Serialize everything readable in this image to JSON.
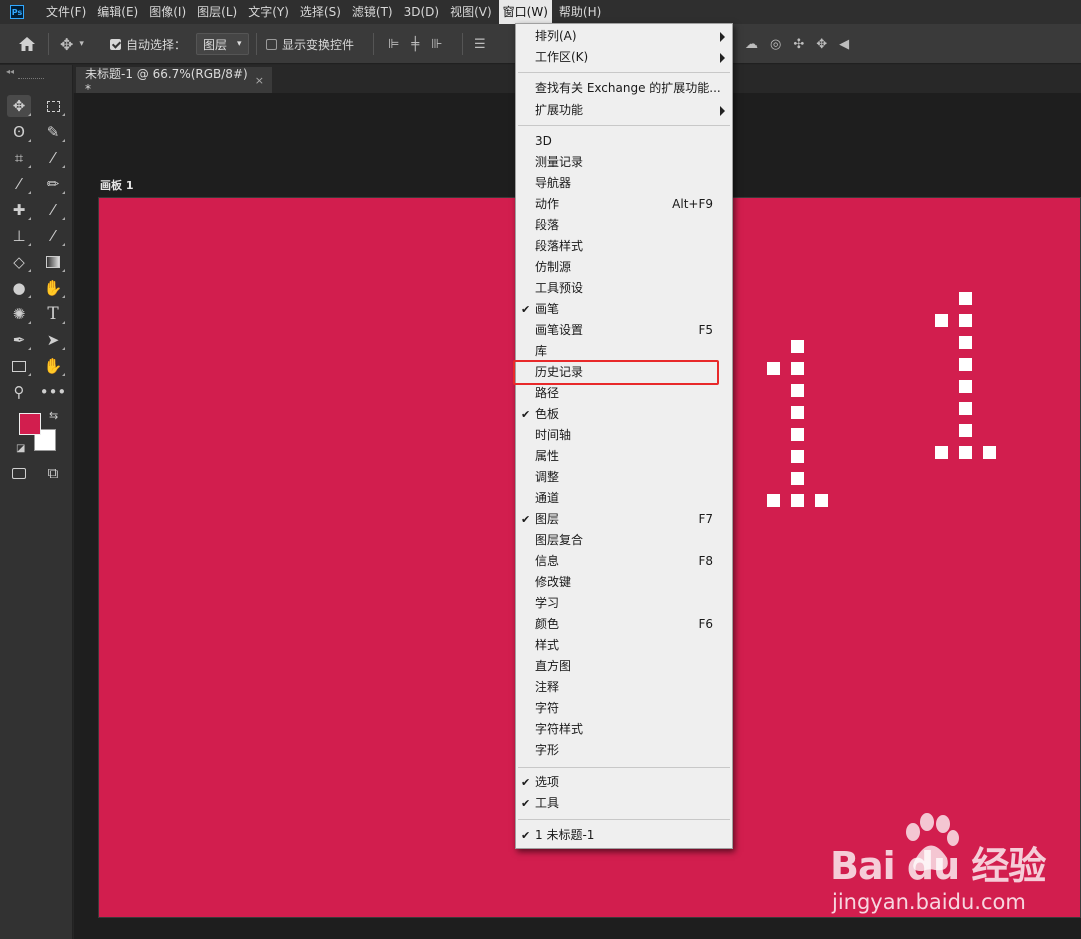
{
  "menubar": {
    "logo": "Ps",
    "items": [
      "文件(F)",
      "编辑(E)",
      "图像(I)",
      "图层(L)",
      "文字(Y)",
      "选择(S)",
      "滤镜(T)",
      "3D(D)",
      "视图(V)",
      "窗口(W)",
      "帮助(H)"
    ],
    "active_item": "窗口(W)"
  },
  "options": {
    "auto_select_label": "自动选择：",
    "auto_select_checked": true,
    "auto_select_target": "图层",
    "show_transform_label": "显示变换控件",
    "show_transform_checked": false
  },
  "document": {
    "tab_title": "未标题-1 @ 66.7%(RGB/8#) *",
    "close_glyph": "×",
    "artboard_label": "画板 1",
    "artboard_color": "#d21e4e"
  },
  "window_menu": {
    "items": [
      {
        "label": "排列(A)",
        "submenu": true
      },
      {
        "label": "工作区(K)",
        "submenu": true
      },
      {
        "label": "查找有关 Exchange 的扩展功能..."
      },
      {
        "label": "扩展功能",
        "submenu": true
      },
      {
        "label": "3D"
      },
      {
        "label": "测量记录"
      },
      {
        "label": "导航器"
      },
      {
        "label": "动作",
        "shortcut": "Alt+F9"
      },
      {
        "label": "段落"
      },
      {
        "label": "段落样式"
      },
      {
        "label": "仿制源"
      },
      {
        "label": "工具预设"
      },
      {
        "label": "画笔",
        "checked": true
      },
      {
        "label": "画笔设置",
        "shortcut": "F5"
      },
      {
        "label": "库"
      },
      {
        "label": "历史记录",
        "highlighted": true
      },
      {
        "label": "路径"
      },
      {
        "label": "色板",
        "checked": true
      },
      {
        "label": "时间轴"
      },
      {
        "label": "属性"
      },
      {
        "label": "调整"
      },
      {
        "label": "通道"
      },
      {
        "label": "图层",
        "checked": true,
        "shortcut": "F7"
      },
      {
        "label": "图层复合"
      },
      {
        "label": "信息",
        "shortcut": "F8"
      },
      {
        "label": "修改键"
      },
      {
        "label": "学习"
      },
      {
        "label": "颜色",
        "shortcut": "F6"
      },
      {
        "label": "样式"
      },
      {
        "label": "直方图"
      },
      {
        "label": "注释"
      },
      {
        "label": "字符"
      },
      {
        "label": "字符样式"
      },
      {
        "label": "字形"
      },
      {
        "label": "选项",
        "checked": true
      },
      {
        "label": "工具",
        "checked": true
      },
      {
        "label": "1 未标题-1",
        "checked": true
      }
    ],
    "check_glyph": "✔",
    "highlight_color": "#e8292a"
  },
  "colors": {
    "foreground": "#d21e4e",
    "background": "#ffffff"
  },
  "watermark": {
    "main": "Bai du 经验",
    "sub": "jingyan.baidu.com"
  }
}
